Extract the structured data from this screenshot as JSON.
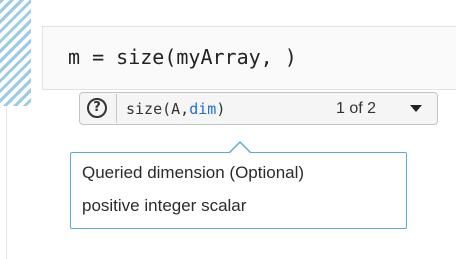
{
  "editor": {
    "code_line": "m = size(myArray, )"
  },
  "signature_bar": {
    "help_icon": "help-circle-icon",
    "help_glyph": "?",
    "function_prefix": "size(A,",
    "active_argument": "dim",
    "function_suffix": ")",
    "overload_counter": "1 of 2",
    "dropdown_icon": "caret-down-icon"
  },
  "tooltip": {
    "description": "Queried dimension (Optional)",
    "type_info": "positive integer scalar"
  },
  "colors": {
    "active_argument": "#1f6fd6",
    "tooltip_border": "#5aa9dc",
    "gutter_stripe": "#9ccbe6"
  }
}
